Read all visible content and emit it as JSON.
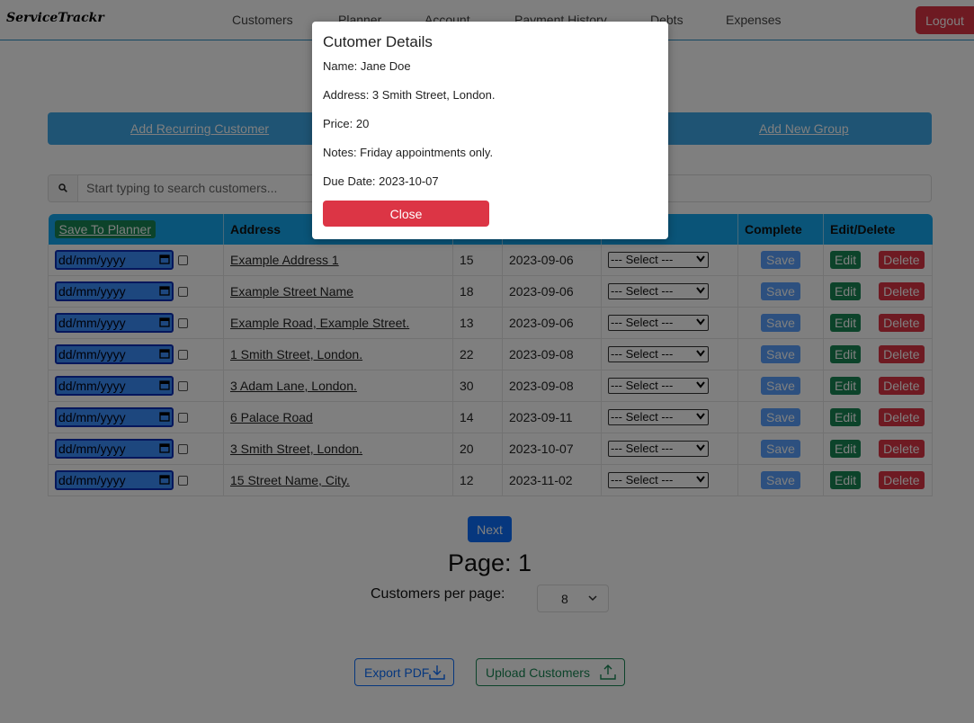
{
  "navbar": {
    "brand": "ServiceTrackr",
    "links": [
      "Customers",
      "Planner",
      "Account",
      "Payment History",
      "Debts",
      "Expenses"
    ],
    "logout_label": "Logout"
  },
  "action_bar": {
    "links": [
      "Add Recurring Customer",
      "Add New Group"
    ]
  },
  "search": {
    "placeholder": "Start typing to search customers..."
  },
  "table": {
    "headers": [
      "Save To Planner",
      "Address",
      "",
      "",
      "",
      "Complete",
      "Edit/Delete"
    ],
    "date_placeholder": "dd/mm/yyyy",
    "select_label": "--- Select ---",
    "save_label": "Save",
    "edit_label": "Edit",
    "delete_label": "Delete",
    "rows": [
      {
        "address": "Example Address 1",
        "price": "15",
        "due": "2023-09-06"
      },
      {
        "address": "Example Street Name",
        "price": "18",
        "due": "2023-09-06"
      },
      {
        "address": "Example Road, Example Street.",
        "price": "13",
        "due": "2023-09-06"
      },
      {
        "address": "1 Smith Street, London.",
        "price": "22",
        "due": "2023-09-08"
      },
      {
        "address": "3 Adam Lane, London.",
        "price": "30",
        "due": "2023-09-08"
      },
      {
        "address": "6 Palace Road",
        "price": "14",
        "due": "2023-09-11"
      },
      {
        "address": "3 Smith Street, London.",
        "price": "20",
        "due": "2023-10-07"
      },
      {
        "address": "15 Street Name, City.",
        "price": "12",
        "due": "2023-11-02"
      }
    ]
  },
  "pagination": {
    "next_label": "Next",
    "page_label": "Page: 1",
    "per_page_label": "Customers per page:",
    "per_page_value": "8"
  },
  "bottom": {
    "export_label": "Export PDF",
    "upload_label": "Upload Customers"
  },
  "modal": {
    "title": "Cutomer Details",
    "name": "Name: Jane Doe",
    "address": "Address: 3 Smith Street, London.",
    "price": "Price: 20",
    "notes": "Notes: Friday appointments only.",
    "due_date": "Due Date: 2023-10-07",
    "close_label": "Close"
  },
  "colors": {
    "accent_blue": "#15a9f0",
    "danger": "#dc3545",
    "success": "#198754",
    "primary": "#0d6efd"
  }
}
